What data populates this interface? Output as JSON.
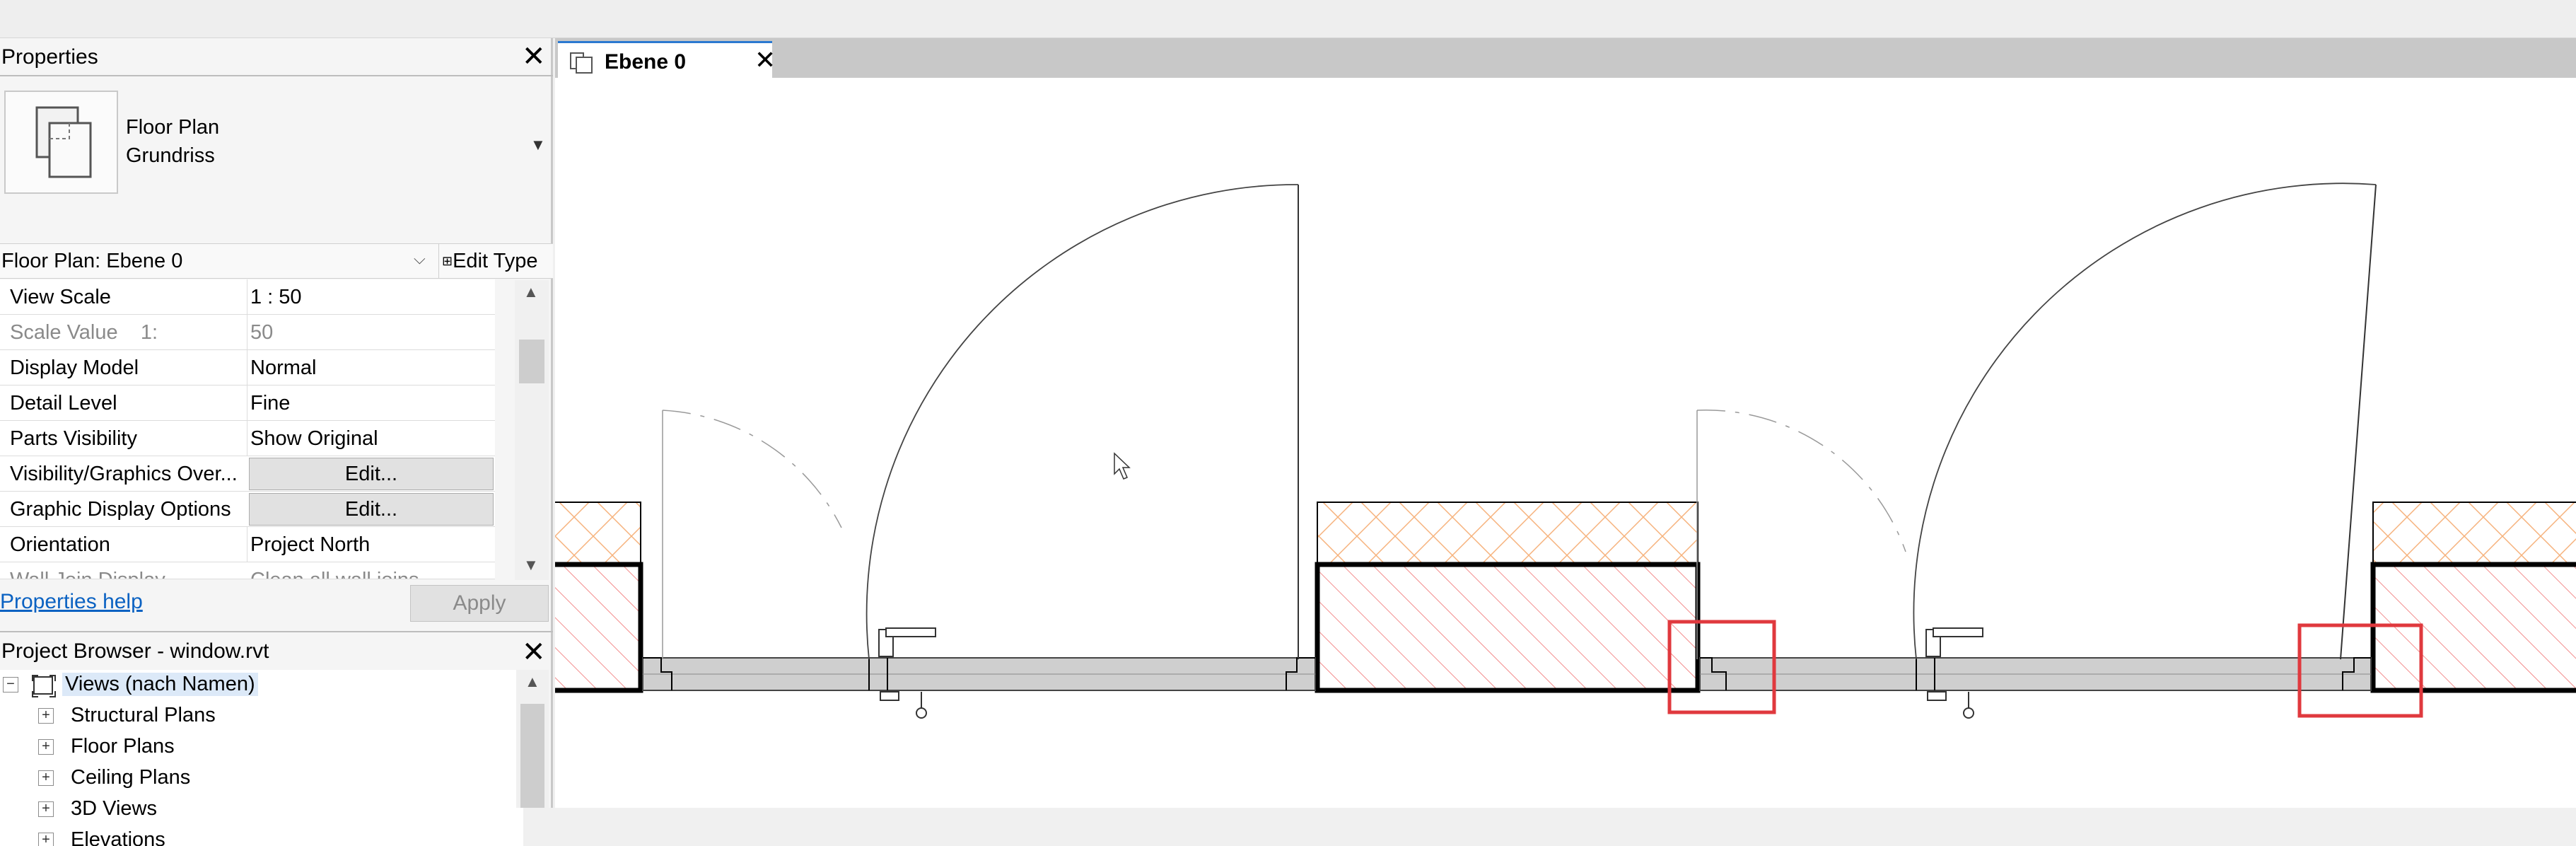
{
  "properties": {
    "title": "Properties",
    "type_name_line1": "Floor Plan",
    "type_name_line2": "Grundriss",
    "instance_selector": "Floor Plan: Ebene 0",
    "edit_type_label": "Edit Type",
    "rows": [
      {
        "name": "View Scale",
        "value": "1 : 50"
      },
      {
        "name": "Scale Value    1:",
        "value": "50"
      },
      {
        "name": "Display Model",
        "value": "Normal"
      },
      {
        "name": "Detail Level",
        "value": "Fine"
      },
      {
        "name": "Parts Visibility",
        "value": "Show Original"
      },
      {
        "name": "Visibility/Graphics Over...",
        "value": "Edit..."
      },
      {
        "name": "Graphic Display Options",
        "value": "Edit..."
      },
      {
        "name": "Orientation",
        "value": "Project North"
      },
      {
        "name": "Wall Join Display",
        "value": "Clean all wall joins"
      }
    ],
    "help_link": "Properties help",
    "apply_label": "Apply"
  },
  "project_browser": {
    "title": "Project Browser - window.rvt",
    "root": "Views (nach Namen)",
    "items": [
      "Structural Plans",
      "Floor Plans",
      "Ceiling Plans",
      "3D Views",
      "Elevations"
    ]
  },
  "view_tab": {
    "label": "Ebene 0"
  },
  "colors": {
    "highlight_red": "#e0393e",
    "cut_hatch": "#f07070",
    "brick_hatch": "#f6b27c",
    "glass_fill": "#cfcfcf",
    "tab_accent": "#2b79d0"
  }
}
